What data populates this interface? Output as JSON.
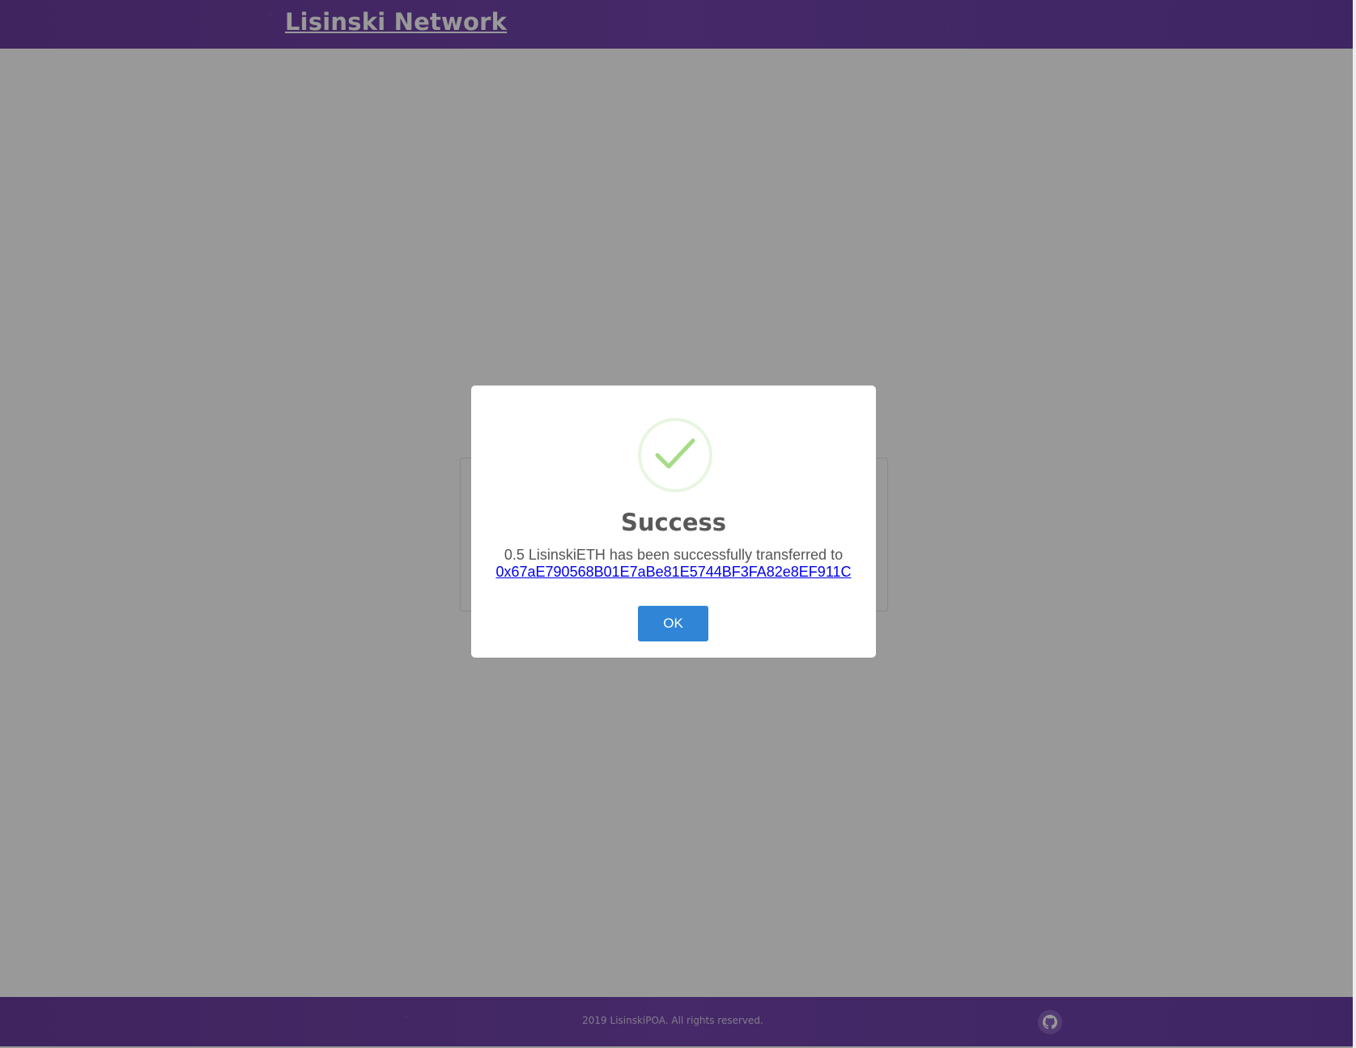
{
  "header": {
    "brand": "Lisinski Network"
  },
  "footer": {
    "copyright": "2019 LisinskiPOA. All rights reserved.",
    "github_icon": "github-icon"
  },
  "modal": {
    "icon": "success-check-icon",
    "title": "Success",
    "message": "0.5 LisinskiETH has been successfully transferred to",
    "address": "0x67aE790568B01E7aBe81E5744BF3FA82e8EF911C",
    "ok_label": "OK"
  },
  "colors": {
    "header_bg": "#6b3fa8",
    "overlay": "rgba(0,0,0,0.4)",
    "success_green": "#a5dc86",
    "button_blue": "#3085d6",
    "link_blue": "#0000ee"
  }
}
